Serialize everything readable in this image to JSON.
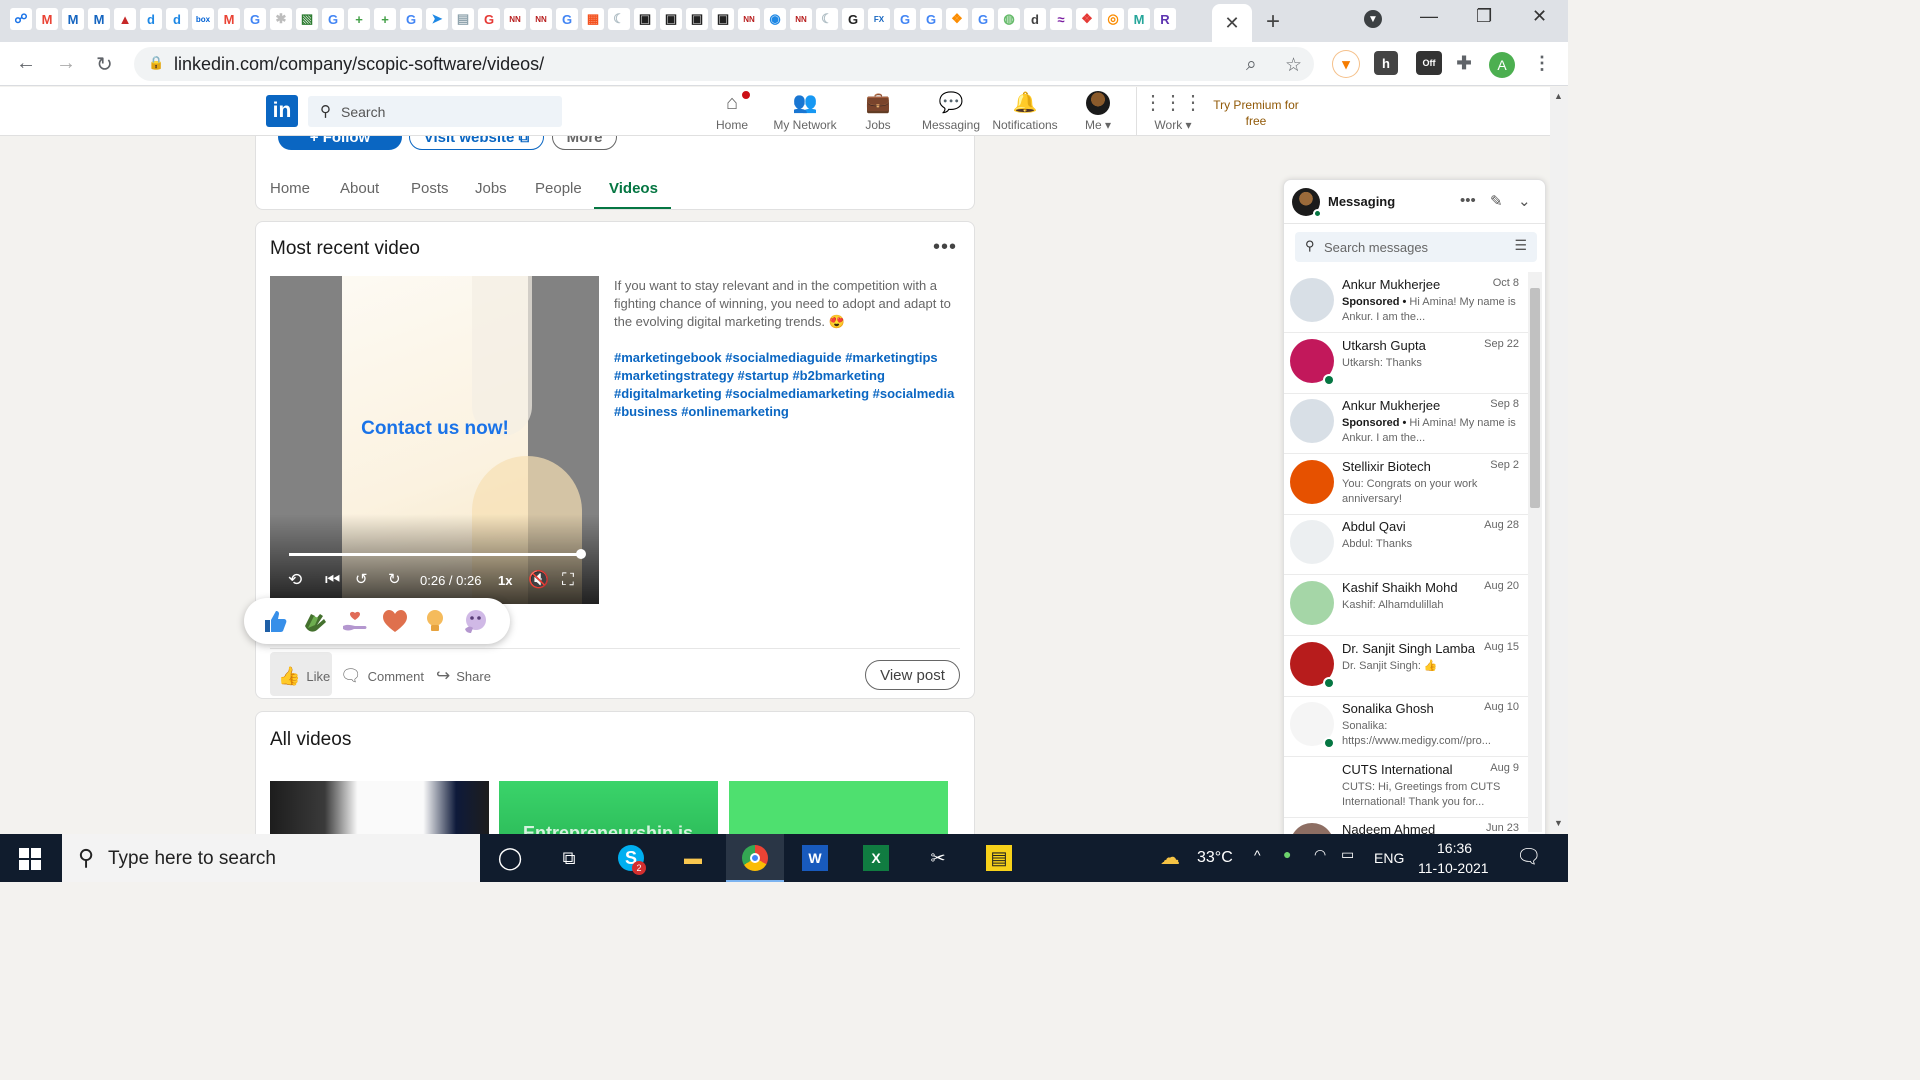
{
  "browser": {
    "url": "linkedin.com/company/scopic-software/videos/",
    "favicons": [
      {
        "name": "tab-icon-1",
        "glyph": "☍",
        "color": "#1a73e8"
      },
      {
        "name": "gmail-icon",
        "glyph": "M",
        "color": "#ea4335"
      },
      {
        "name": "tab-icon-m1",
        "glyph": "M",
        "color": "#1565c0"
      },
      {
        "name": "tab-icon-m2",
        "glyph": "M",
        "color": "#1565c0"
      },
      {
        "name": "tab-icon-red",
        "glyph": "▲",
        "color": "#c62828"
      },
      {
        "name": "tab-icon-d1",
        "glyph": "d",
        "color": "#1e88e5"
      },
      {
        "name": "tab-icon-d2",
        "glyph": "d",
        "color": "#1e88e5"
      },
      {
        "name": "box-icon",
        "glyph": "box",
        "color": "#0061d5"
      },
      {
        "name": "gmail-icon-2",
        "glyph": "M",
        "color": "#ea4335"
      },
      {
        "name": "google-icon-1",
        "glyph": "G",
        "color": "#4285f4"
      },
      {
        "name": "tab-icon-loading",
        "glyph": "✱",
        "color": "#bdbdbd"
      },
      {
        "name": "tab-icon-green-1",
        "glyph": "▧",
        "color": "#2e7d32"
      },
      {
        "name": "google-icon-2",
        "glyph": "G",
        "color": "#4285f4"
      },
      {
        "name": "plus-green-icon-1",
        "glyph": "+",
        "color": "#43a047"
      },
      {
        "name": "plus-green-icon-2",
        "glyph": "+",
        "color": "#43a047"
      },
      {
        "name": "google-icon-3",
        "glyph": "G",
        "color": "#4285f4"
      },
      {
        "name": "send-icon",
        "glyph": "➤",
        "color": "#1e88e5"
      },
      {
        "name": "cart-icon",
        "glyph": "▤",
        "color": "#90a4ae"
      },
      {
        "name": "tab-icon-g-red",
        "glyph": "G",
        "color": "#e53935"
      },
      {
        "name": "nn-icon-1",
        "glyph": "NN",
        "color": "#b71c1c"
      },
      {
        "name": "nn-icon-2",
        "glyph": "NN",
        "color": "#b71c1c"
      },
      {
        "name": "google-icon-4",
        "glyph": "G",
        "color": "#4285f4"
      },
      {
        "name": "tab-icon-grid",
        "glyph": "▦",
        "color": "#f4511e"
      },
      {
        "name": "tab-icon-moon",
        "glyph": "☾",
        "color": "#b0bec5"
      },
      {
        "name": "gpm-icon-1",
        "glyph": "▣",
        "color": "#212121"
      },
      {
        "name": "gpm-icon-2",
        "glyph": "▣",
        "color": "#212121"
      },
      {
        "name": "gpm-icon-3",
        "glyph": "▣",
        "color": "#212121"
      },
      {
        "name": "gpm-icon-4",
        "glyph": "▣",
        "color": "#212121"
      },
      {
        "name": "nn-icon-3",
        "glyph": "NN",
        "color": "#b71c1c"
      },
      {
        "name": "tab-icon-shield",
        "glyph": "◉",
        "color": "#1e88e5"
      },
      {
        "name": "nn-icon-4",
        "glyph": "NN",
        "color": "#b71c1c"
      },
      {
        "name": "tab-icon-moon-2",
        "glyph": "☾",
        "color": "#b0bec5"
      },
      {
        "name": "google-icon-5",
        "glyph": "G",
        "color": "#212121"
      },
      {
        "name": "fx-icon",
        "glyph": "FX",
        "color": "#1565c0"
      },
      {
        "name": "google-icon-6",
        "glyph": "G",
        "color": "#4285f4"
      },
      {
        "name": "google-icon-7",
        "glyph": "G",
        "color": "#4285f4"
      },
      {
        "name": "tab-icon-colorful",
        "glyph": "❖",
        "color": "#fb8c00"
      },
      {
        "name": "google-icon-8",
        "glyph": "G",
        "color": "#4285f4"
      },
      {
        "name": "tab-icon-round",
        "glyph": "◍",
        "color": "#66bb6a"
      },
      {
        "name": "tab-icon-d3",
        "glyph": "d",
        "color": "#424242"
      },
      {
        "name": "tab-icon-wave",
        "glyph": "≈",
        "color": "#7b1fa2"
      },
      {
        "name": "tab-icon-colorful-2",
        "glyph": "❖",
        "color": "#e53935"
      },
      {
        "name": "tab-icon-ring",
        "glyph": "◎",
        "color": "#fb8c00"
      },
      {
        "name": "tab-icon-m3",
        "glyph": "M",
        "color": "#26a69a"
      },
      {
        "name": "rand-icon",
        "glyph": "R",
        "color": "#5e35b1"
      }
    ]
  },
  "linkedin": {
    "search_placeholder": "Search",
    "nav": [
      {
        "name": "nav-home",
        "label": "Home",
        "icon": "home-icon"
      },
      {
        "name": "nav-my-network",
        "label": "My Network",
        "icon": "people-icon"
      },
      {
        "name": "nav-jobs",
        "label": "Jobs",
        "icon": "briefcase-icon"
      },
      {
        "name": "nav-messaging",
        "label": "Messaging",
        "icon": "chat-icon"
      },
      {
        "name": "nav-notifications",
        "label": "Notifications",
        "icon": "bell-icon"
      },
      {
        "name": "nav-me",
        "label": "Me",
        "icon": "avatar"
      },
      {
        "name": "nav-work",
        "label": "Work",
        "icon": "grid-icon"
      }
    ],
    "premium": "Try Premium for free"
  },
  "company": {
    "follow_label": "+ Follow",
    "website_label": "Visit website",
    "more_label": "More",
    "tabs": [
      "Home",
      "About",
      "Posts",
      "Jobs",
      "People",
      "Videos"
    ],
    "active_tab": "Videos"
  },
  "recent_video": {
    "heading": "Most recent video",
    "video_text": "Contact us now!",
    "time": "0:26 / 0:26",
    "speed": "1x",
    "progress": 1.0,
    "description": "If you want to stay relevant and in the competition with a fighting chance of winning, you need to adopt and adapt to the evolving digital marketing trends. 😍",
    "hashtags": "#marketingebook #socialmediaguide #marketingtips #marketingstrategy #startup #b2bmarketing #digitalmarketing #socialmediamarketing #socialmedia #business #onlinemarketing",
    "actions": {
      "like": "Like",
      "comment": "Comment",
      "share": "Share",
      "view_post": "View post"
    },
    "reactions": [
      "like-reaction-icon",
      "celebrate-reaction-icon",
      "support-reaction-icon",
      "love-reaction-icon",
      "insightful-reaction-icon",
      "curious-reaction-icon"
    ]
  },
  "all_videos": {
    "heading": "All videos",
    "thumb2_text": "Entrepreneurship is"
  },
  "messaging": {
    "title": "Messaging",
    "search_placeholder": "Search messages",
    "conversations": [
      {
        "name": "Ankur Mukherjee",
        "date": "Oct 8",
        "sponsored": "Sponsored •",
        "preview": " Hi Amina! My name is Ankur. I am the...",
        "online": false,
        "avatar_color": "#d8dfe6"
      },
      {
        "name": "Utkarsh Gupta",
        "date": "Sep 22",
        "sponsored": "",
        "preview": "Utkarsh: Thanks",
        "online": true,
        "avatar_color": "#c2185b"
      },
      {
        "name": "Ankur Mukherjee",
        "date": "Sep 8",
        "sponsored": "Sponsored •",
        "preview": " Hi Amina! My name is Ankur. I am the...",
        "online": false,
        "avatar_color": "#d8dfe6"
      },
      {
        "name": "Stellixir Biotech",
        "date": "Sep 2",
        "sponsored": "",
        "preview": "You: Congrats on your work anniversary!",
        "online": false,
        "avatar_color": "#e65100"
      },
      {
        "name": "Abdul Qavi",
        "date": "Aug 28",
        "sponsored": "",
        "preview": "Abdul: Thanks",
        "online": false,
        "avatar_color": "#eceff1"
      },
      {
        "name": "Kashif Shaikh Mohd",
        "date": "Aug 20",
        "sponsored": "",
        "preview": "Kashif: Alhamdulillah",
        "online": false,
        "avatar_color": "#a5d6a7"
      },
      {
        "name": "Dr. Sanjit Singh Lamba",
        "date": "Aug 15",
        "sponsored": "",
        "preview": "Dr. Sanjit Singh: 👍",
        "online": true,
        "avatar_color": "#b71c1c"
      },
      {
        "name": "Sonalika Ghosh",
        "date": "Aug 10",
        "sponsored": "",
        "preview": "Sonalika: https://www.medigy.com//pro...",
        "online": true,
        "avatar_color": "#f5f5f5"
      },
      {
        "name": "CUTS International",
        "date": "Aug 9",
        "sponsored": "",
        "preview": "CUTS: Hi, Greetings from CUTS International! Thank you for...",
        "online": false,
        "avatar_color": "#ffffff"
      },
      {
        "name": "Nadeem Ahmed",
        "date": "Jun 23",
        "sponsored": "",
        "preview": "",
        "online": false,
        "avatar_color": "#8d6e63"
      }
    ]
  },
  "taskbar": {
    "search_placeholder": "Type here to search",
    "temperature": "33°C",
    "language": "ENG",
    "time": "16:36",
    "date": "11-10-2021",
    "skype_badge": "2"
  },
  "colors": {
    "linkedin_blue": "#0a66c2",
    "active_green": "#057642",
    "video_cta": "#1a73e8"
  }
}
